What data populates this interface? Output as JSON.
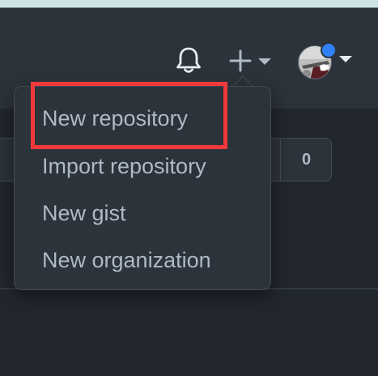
{
  "header": {
    "notifications_icon": "bell-icon",
    "create_icon": "plus-icon",
    "create_caret_icon": "caret-down-icon",
    "avatar_caret_icon": "caret-down-icon",
    "avatar_status_color": "#2f81f7"
  },
  "background_counter": {
    "value": "0"
  },
  "dropdown": {
    "items": [
      {
        "label": "New repository"
      },
      {
        "label": "Import repository"
      },
      {
        "label": "New gist"
      },
      {
        "label": "New organization"
      }
    ]
  },
  "colors": {
    "header_bg": "#2d333b",
    "page_bg": "#22272e",
    "text": "#adbac7",
    "border": "#444c56",
    "highlight": "#f0393b"
  }
}
